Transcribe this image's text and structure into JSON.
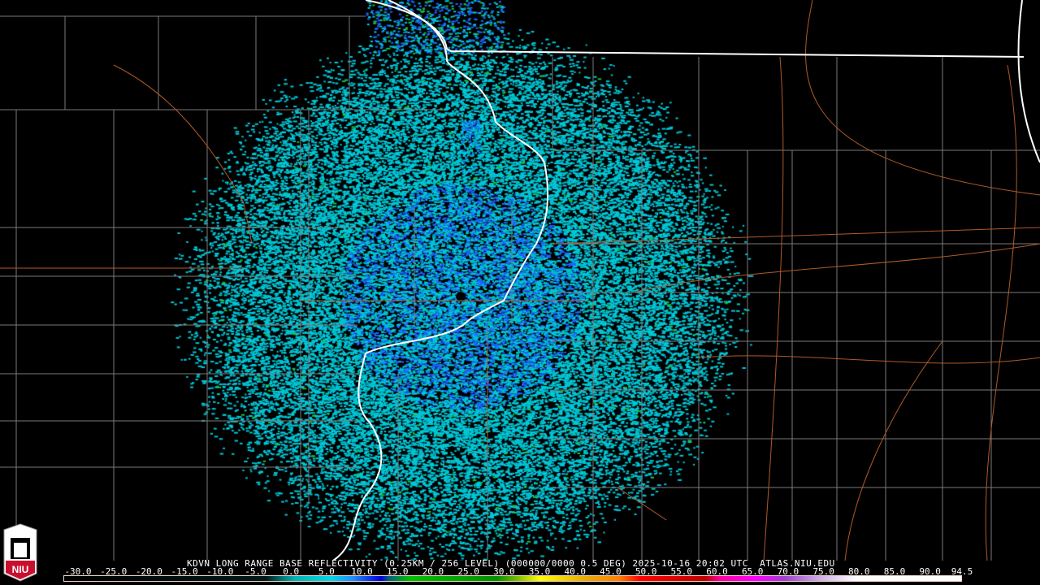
{
  "title": "KDVN LONG RANGE BASE REFLECTIVITY (0.25KM / 256 LEVEL) (000000/0000 0.5 DEG) 2025-10-16 20:02 UTC  ATLAS.NIU.EDU",
  "logo_text": "NIU",
  "colorbar": {
    "min": -30,
    "max": 94.5,
    "labels": [
      "-30.0",
      "-25.0",
      "-20.0",
      "-15.0",
      "-10.0",
      "-5.0",
      "0.0",
      "5.0",
      "10.0",
      "15.0",
      "20.0",
      "25.0",
      "30.0",
      "35.0",
      "40.0",
      "45.0",
      "50.0",
      "55.0",
      "60.0",
      "65.0",
      "70.0",
      "75.0",
      "80.0",
      "85.0",
      "90.0",
      "94.5"
    ],
    "stops": [
      {
        "v": -30,
        "c": "#000000"
      },
      {
        "v": -2,
        "c": "#001a1a"
      },
      {
        "v": 0,
        "c": "#006e6e"
      },
      {
        "v": 2,
        "c": "#00b4b4"
      },
      {
        "v": 7,
        "c": "#00d8e8"
      },
      {
        "v": 10,
        "c": "#1e90ff"
      },
      {
        "v": 14,
        "c": "#0000dc"
      },
      {
        "v": 15,
        "c": "#006080"
      },
      {
        "v": 18,
        "c": "#00c000"
      },
      {
        "v": 30,
        "c": "#009000"
      },
      {
        "v": 33,
        "c": "#80c000"
      },
      {
        "v": 36,
        "c": "#ffff00"
      },
      {
        "v": 42,
        "c": "#e8b000"
      },
      {
        "v": 47,
        "c": "#ff8000"
      },
      {
        "v": 50,
        "c": "#ff0000"
      },
      {
        "v": 59,
        "c": "#c00000"
      },
      {
        "v": 61,
        "c": "#ff00a0"
      },
      {
        "v": 66,
        "c": "#ff00ff"
      },
      {
        "v": 70,
        "c": "#a040d0"
      },
      {
        "v": 75,
        "c": "#d0b0e8"
      },
      {
        "v": 80,
        "c": "#ffffff"
      },
      {
        "v": 94.5,
        "c": "#ffffff"
      }
    ]
  },
  "colors": {
    "state_border": "#ffffff",
    "county": "#808080",
    "road": "#b05a28",
    "echo_light": "#00c8d8",
    "echo_mid": "#1e64ff",
    "echo_green": "#20c020"
  }
}
